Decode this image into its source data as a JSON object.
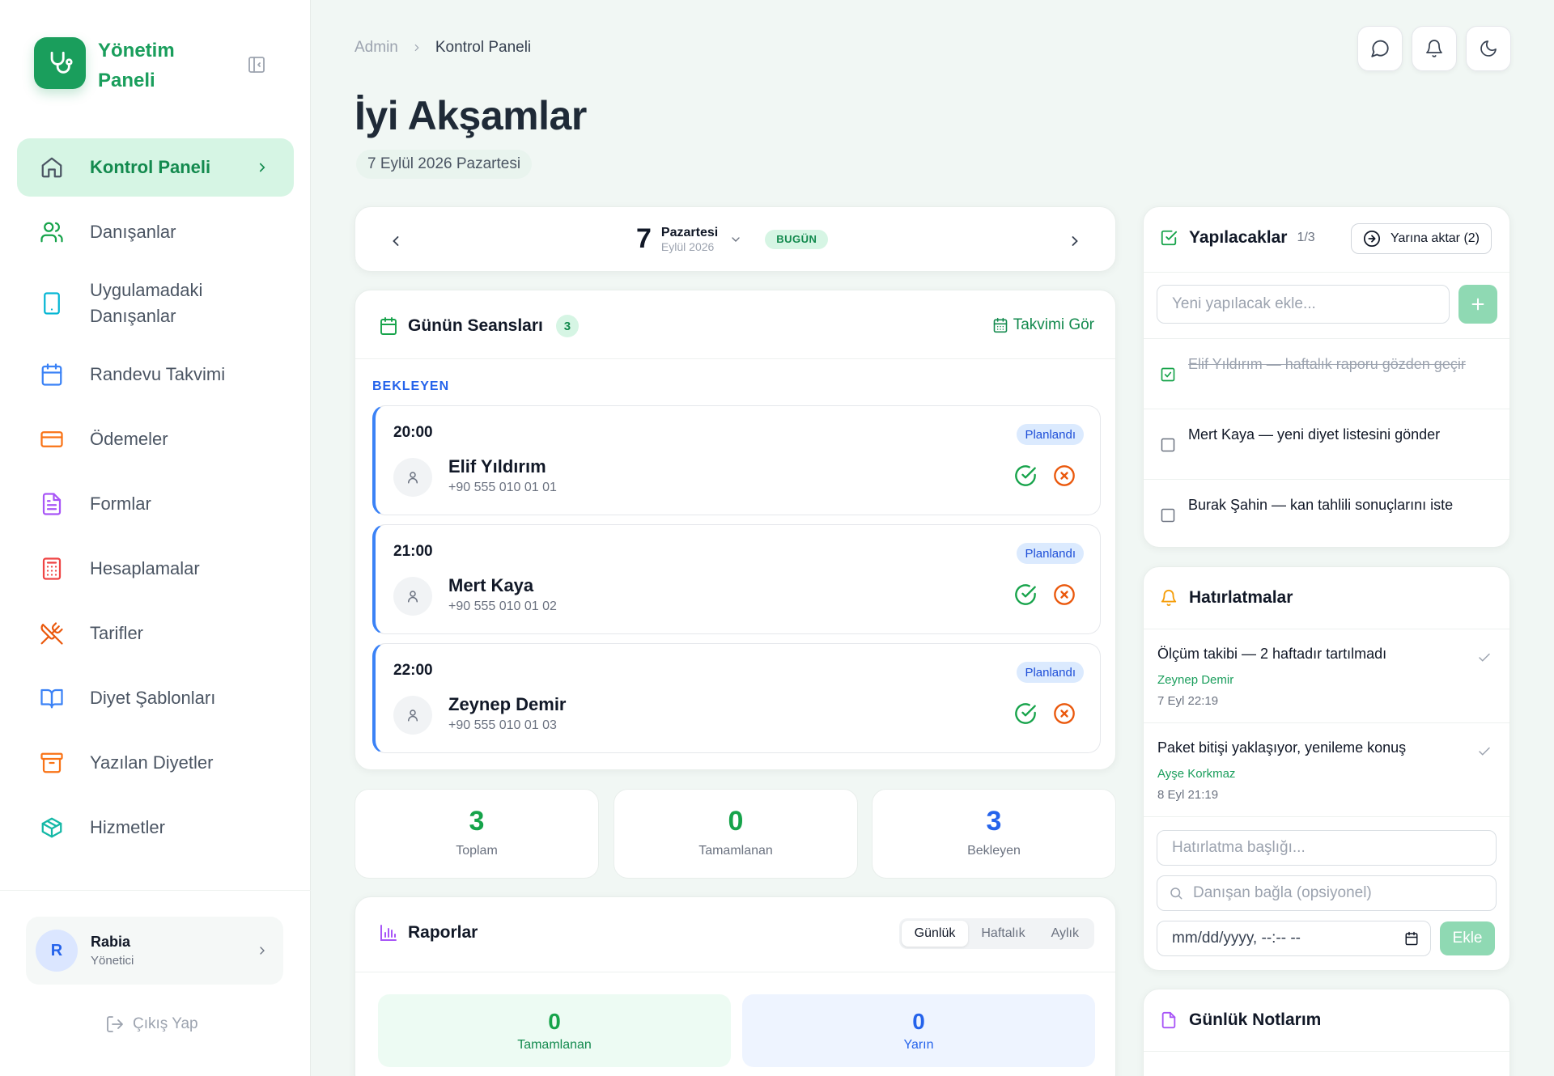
{
  "sidebar": {
    "brand": "Yönetim Paneli",
    "items": [
      {
        "label": "Kontrol Paneli"
      },
      {
        "label": "Danışanlar"
      },
      {
        "label": "Uygulamadaki Danışanlar"
      },
      {
        "label": "Randevu Takvimi"
      },
      {
        "label": "Ödemeler"
      },
      {
        "label": "Formlar"
      },
      {
        "label": "Hesaplamalar"
      },
      {
        "label": "Tarifler"
      },
      {
        "label": "Diyet Şablonları"
      },
      {
        "label": "Yazılan Diyetler"
      },
      {
        "label": "Hizmetler"
      }
    ],
    "user": {
      "initial": "R",
      "name": "Rabia",
      "role": "Yönetici"
    },
    "logout": "Çıkış Yap"
  },
  "header": {
    "breadcrumb": [
      "Admin",
      "Kontrol Paneli"
    ],
    "greeting": "İyi Akşamlar",
    "date": "7 Eylül 2026 Pazartesi"
  },
  "date_nav": {
    "day": "7",
    "weekday": "Pazartesi",
    "month_year": "Eylül 2026",
    "today_badge": "BUGÜN"
  },
  "sessions": {
    "title": "Günün Seansları",
    "count": "3",
    "calendar_link": "Takvimi Gör",
    "group_label": "BEKLEYEN",
    "items": [
      {
        "time": "20:00",
        "status": "Planlandı",
        "name": "Elif Yıldırım",
        "phone": "+90 555 010 01 01"
      },
      {
        "time": "21:00",
        "status": "Planlandı",
        "name": "Mert Kaya",
        "phone": "+90 555 010 01 02"
      },
      {
        "time": "22:00",
        "status": "Planlandı",
        "name": "Zeynep Demir",
        "phone": "+90 555 010 01 03"
      }
    ]
  },
  "stats": [
    {
      "value": "3",
      "label": "Toplam",
      "color": "#16a34a"
    },
    {
      "value": "0",
      "label": "Tamamlanan",
      "color": "#16a34a"
    },
    {
      "value": "3",
      "label": "Bekleyen",
      "color": "#2563eb"
    }
  ],
  "reports": {
    "title": "Raporlar",
    "tabs": [
      "Günlük",
      "Haftalık",
      "Aylık"
    ],
    "active_tab": "Günlük",
    "boxes": [
      {
        "value": "0",
        "label": "Tamamlanan"
      },
      {
        "value": "0",
        "label": "Yarın"
      }
    ]
  },
  "todos": {
    "title": "Yapılacaklar",
    "count": "1/3",
    "move_button": "Yarına aktar (2)",
    "input_placeholder": "Yeni yapılacak ekle...",
    "items": [
      {
        "text": "Elif Yıldırım — haftalık raporu gözden geçir",
        "done": true
      },
      {
        "text": "Mert Kaya — yeni diyet listesini gönder",
        "done": false
      },
      {
        "text": "Burak Şahin — kan tahlili sonuçlarını iste",
        "done": false
      }
    ]
  },
  "reminders": {
    "title": "Hatırlatmalar",
    "items": [
      {
        "title": "Ölçüm takibi — 2 haftadır tartılmadı",
        "client": "Zeynep Demir",
        "date": "7 Eyl 22:19"
      },
      {
        "title": "Paket bitişi yaklaşıyor, yenileme konuş",
        "client": "Ayşe Korkmaz",
        "date": "8 Eyl 21:19"
      }
    ],
    "title_placeholder": "Hatırlatma başlığı...",
    "client_placeholder": "Danışan bağla (opsiyonel)",
    "datetime_placeholder": "mm/dd/yyyy, --:-- --",
    "add_button": "Ekle"
  },
  "notes": {
    "title": "Günlük Notlarım"
  },
  "colors": {
    "accent": "#1a9e5c",
    "accent_light": "#d6f5e4",
    "blue": "#2563eb",
    "danger": "#ea580c"
  }
}
